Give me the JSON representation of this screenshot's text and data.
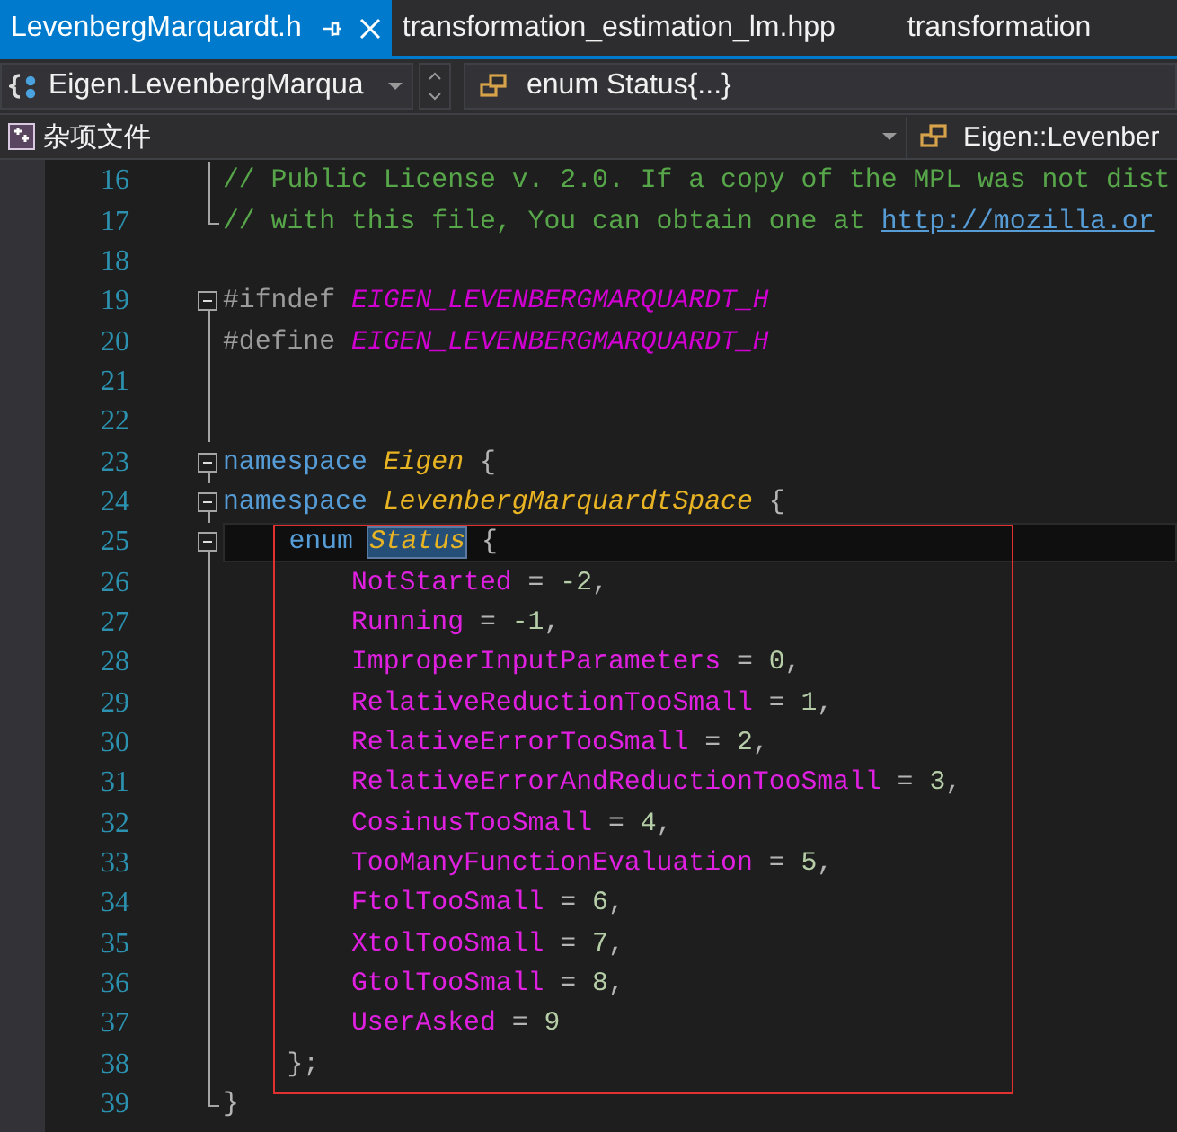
{
  "tabs": [
    {
      "label": "LevenbergMarquardt.h",
      "selected": true
    },
    {
      "label": "transformation_estimation_lm.hpp",
      "selected": false
    },
    {
      "label": "transformation",
      "selected": false
    }
  ],
  "navigation_bar": {
    "scope": "Eigen.LevenbergMarqua",
    "member": "enum Status{...}"
  },
  "project_bar": {
    "project": "杂项文件",
    "symbol": "Eigen::Levenber"
  },
  "code": {
    "blocks": [
      {
        "kind": "plain",
        "lines": [
          {
            "number": "16",
            "kind": "body",
            "current": false,
            "tokens": [
              {
                "kind": "comment",
                "text": "// Public License v. 2.0. If a copy of the MPL was not dist"
              }
            ]
          },
          {
            "number": "17",
            "kind": "end",
            "current": false,
            "tokens": [
              {
                "kind": "comment",
                "text": "// with this file, You can obtain one at "
              },
              {
                "kind": "link",
                "text": "http://mozilla.or"
              }
            ]
          },
          {
            "number": "18",
            "kind": "plain",
            "current": false
          },
          {
            "number": "19",
            "kind": "start",
            "current": false,
            "tokens": [
              {
                "kind": "preproc",
                "text": "#ifndef "
              },
              {
                "kind": "macro",
                "text": "EIGEN_LEVENBERGMARQUARDT_H"
              }
            ]
          },
          {
            "number": "20",
            "kind": "body",
            "current": false,
            "tokens": [
              {
                "kind": "preproc",
                "text": "#define "
              },
              {
                "kind": "macro",
                "text": "EIGEN_LEVENBERGMARQUARDT_H"
              }
            ]
          },
          {
            "number": "21",
            "kind": "body",
            "current": false
          },
          {
            "number": "22",
            "kind": "body",
            "current": false
          },
          {
            "number": "23",
            "kind": "start",
            "current": false,
            "tokens": [
              {
                "kind": "keyword",
                "text": "namespace "
              },
              {
                "kind": "type",
                "text": "Eigen"
              },
              {
                "kind": "punct",
                "text": " {"
              }
            ]
          },
          {
            "number": "24",
            "kind": "start",
            "current": false,
            "tokens": [
              {
                "kind": "keyword",
                "text": "namespace "
              },
              {
                "kind": "type",
                "text": "LevenbergMarquardtSpace"
              },
              {
                "kind": "punct",
                "text": " {"
              }
            ]
          }
        ]
      },
      {
        "kind": "boxed",
        "lines": [
          {
            "number": "25",
            "kind": "start",
            "current": true,
            "tokens": [
              {
                "kind": "keyword",
                "text": "    enum "
              },
              {
                "kind": "reference",
                "text": "Status"
              },
              {
                "kind": "punct",
                "text": " {"
              }
            ]
          },
          {
            "number": "26",
            "kind": "body",
            "current": false,
            "tokens": [
              {
                "kind": "enumerator",
                "text": "        NotStarted"
              },
              {
                "kind": "punct",
                "text": " = "
              },
              {
                "kind": "number",
                "text": "-2"
              },
              {
                "kind": "punct",
                "text": ","
              }
            ]
          },
          {
            "number": "27",
            "kind": "body",
            "current": false,
            "tokens": [
              {
                "kind": "enumerator",
                "text": "        Running"
              },
              {
                "kind": "punct",
                "text": " = "
              },
              {
                "kind": "number",
                "text": "-1"
              },
              {
                "kind": "punct",
                "text": ","
              }
            ]
          },
          {
            "number": "28",
            "kind": "body",
            "current": false,
            "tokens": [
              {
                "kind": "enumerator",
                "text": "        ImproperInputParameters"
              },
              {
                "kind": "punct",
                "text": " = "
              },
              {
                "kind": "number",
                "text": "0"
              },
              {
                "kind": "punct",
                "text": ","
              }
            ]
          },
          {
            "number": "29",
            "kind": "body",
            "current": false,
            "tokens": [
              {
                "kind": "enumerator",
                "text": "        RelativeReductionTooSmall"
              },
              {
                "kind": "punct",
                "text": " = "
              },
              {
                "kind": "number",
                "text": "1"
              },
              {
                "kind": "punct",
                "text": ","
              }
            ]
          },
          {
            "number": "30",
            "kind": "body",
            "current": false,
            "tokens": [
              {
                "kind": "enumerator",
                "text": "        RelativeErrorTooSmall"
              },
              {
                "kind": "punct",
                "text": " = "
              },
              {
                "kind": "number",
                "text": "2"
              },
              {
                "kind": "punct",
                "text": ","
              }
            ]
          },
          {
            "number": "31",
            "kind": "body",
            "current": false,
            "tokens": [
              {
                "kind": "enumerator",
                "text": "        RelativeErrorAndReductionTooSmall"
              },
              {
                "kind": "punct",
                "text": " = "
              },
              {
                "kind": "number",
                "text": "3"
              },
              {
                "kind": "punct",
                "text": ","
              }
            ]
          },
          {
            "number": "32",
            "kind": "body",
            "current": false,
            "tokens": [
              {
                "kind": "enumerator",
                "text": "        CosinusTooSmall"
              },
              {
                "kind": "punct",
                "text": " = "
              },
              {
                "kind": "number",
                "text": "4"
              },
              {
                "kind": "punct",
                "text": ","
              }
            ]
          },
          {
            "number": "33",
            "kind": "body",
            "current": false,
            "tokens": [
              {
                "kind": "enumerator",
                "text": "        TooManyFunctionEvaluation"
              },
              {
                "kind": "punct",
                "text": " = "
              },
              {
                "kind": "number",
                "text": "5"
              },
              {
                "kind": "punct",
                "text": ","
              }
            ]
          },
          {
            "number": "34",
            "kind": "body",
            "current": false,
            "tokens": [
              {
                "kind": "enumerator",
                "text": "        FtolTooSmall"
              },
              {
                "kind": "punct",
                "text": " = "
              },
              {
                "kind": "number",
                "text": "6"
              },
              {
                "kind": "punct",
                "text": ","
              }
            ]
          },
          {
            "number": "35",
            "kind": "body",
            "current": false,
            "tokens": [
              {
                "kind": "enumerator",
                "text": "        XtolTooSmall"
              },
              {
                "kind": "punct",
                "text": " = "
              },
              {
                "kind": "number",
                "text": "7"
              },
              {
                "kind": "punct",
                "text": ","
              }
            ]
          },
          {
            "number": "36",
            "kind": "body",
            "current": false,
            "tokens": [
              {
                "kind": "enumerator",
                "text": "        GtolTooSmall"
              },
              {
                "kind": "punct",
                "text": " = "
              },
              {
                "kind": "number",
                "text": "8"
              },
              {
                "kind": "punct",
                "text": ","
              }
            ]
          },
          {
            "number": "37",
            "kind": "body",
            "current": false,
            "tokens": [
              {
                "kind": "enumerator",
                "text": "        UserAsked"
              },
              {
                "kind": "punct",
                "text": " = "
              },
              {
                "kind": "number",
                "text": "9"
              }
            ]
          },
          {
            "number": "38",
            "kind": "body",
            "current": false,
            "tokens": [
              {
                "kind": "punct",
                "text": "    };"
              }
            ]
          }
        ]
      },
      {
        "kind": "plain",
        "lines": [
          {
            "number": "39",
            "kind": "end",
            "current": false,
            "tokens": [
              {
                "kind": "punct",
                "text": "}"
              }
            ]
          }
        ]
      }
    ]
  }
}
